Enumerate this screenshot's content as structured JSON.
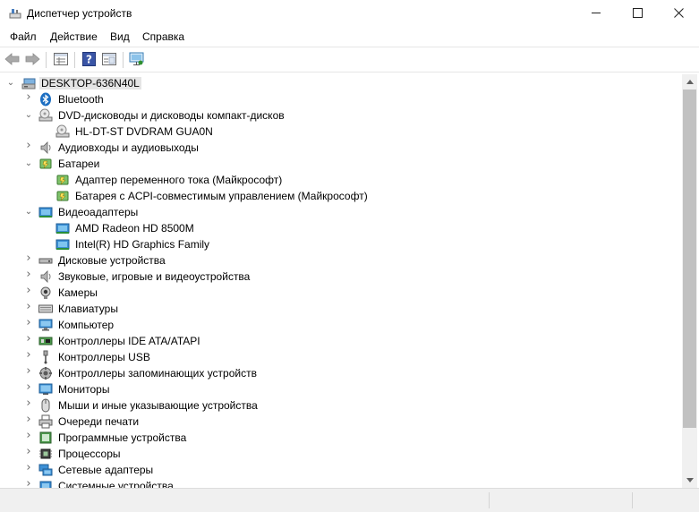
{
  "window": {
    "title": "Диспетчер устройств",
    "icon": "device-manager-icon",
    "controls": [
      "minimize-icon",
      "maximize-icon",
      "close-icon"
    ]
  },
  "menu": {
    "items": [
      "Файл",
      "Действие",
      "Вид",
      "Справка"
    ]
  },
  "toolbar": {
    "buttons": [
      "back-arrow-icon",
      "forward-arrow-icon",
      "properties-view-icon",
      "help-icon",
      "details-pane-icon",
      "scan-hardware-icon"
    ]
  },
  "tree": {
    "root": "DESKTOP-636N40L",
    "items": [
      {
        "label": "Bluetooth",
        "icon": "bluetooth-icon",
        "expanded": false,
        "level": 1
      },
      {
        "label": "DVD-дисководы и дисководы компакт-дисков",
        "icon": "dvd-drive-icon",
        "expanded": true,
        "level": 1
      },
      {
        "label": "HL-DT-ST DVDRAM GUA0N",
        "icon": "dvd-drive-icon",
        "level": 2
      },
      {
        "label": "Аудиовходы и аудиовыходы",
        "icon": "speaker-icon",
        "expanded": false,
        "level": 1
      },
      {
        "label": "Батареи",
        "icon": "battery-icon",
        "expanded": true,
        "level": 1
      },
      {
        "label": "Адаптер переменного тока (Майкрософт)",
        "icon": "battery-icon",
        "level": 2
      },
      {
        "label": "Батарея с ACPI-совместимым управлением (Майкрософт)",
        "icon": "battery-icon",
        "level": 2
      },
      {
        "label": "Видеоадаптеры",
        "icon": "display-adapter-icon",
        "expanded": true,
        "level": 1
      },
      {
        "label": "AMD Radeon HD 8500M",
        "icon": "display-adapter-icon",
        "level": 2
      },
      {
        "label": "Intel(R) HD Graphics Family",
        "icon": "display-adapter-icon",
        "level": 2
      },
      {
        "label": "Дисковые устройства",
        "icon": "disk-drive-icon",
        "expanded": false,
        "level": 1
      },
      {
        "label": "Звуковые, игровые и видеоустройства",
        "icon": "speaker-icon",
        "expanded": false,
        "level": 1
      },
      {
        "label": "Камеры",
        "icon": "camera-icon",
        "expanded": false,
        "level": 1
      },
      {
        "label": "Клавиатуры",
        "icon": "keyboard-icon",
        "expanded": false,
        "level": 1
      },
      {
        "label": "Компьютер",
        "icon": "computer-icon",
        "expanded": false,
        "level": 1
      },
      {
        "label": "Контроллеры IDE ATA/ATAPI",
        "icon": "ide-controller-icon",
        "expanded": false,
        "level": 1
      },
      {
        "label": "Контроллеры USB",
        "icon": "usb-icon",
        "expanded": false,
        "level": 1
      },
      {
        "label": "Контроллеры запоминающих устройств",
        "icon": "storage-controller-icon",
        "expanded": false,
        "level": 1
      },
      {
        "label": "Мониторы",
        "icon": "monitor-icon",
        "expanded": false,
        "level": 1
      },
      {
        "label": "Мыши и иные указывающие устройства",
        "icon": "mouse-icon",
        "expanded": false,
        "level": 1
      },
      {
        "label": "Очереди печати",
        "icon": "printer-icon",
        "expanded": false,
        "level": 1
      },
      {
        "label": "Программные устройства",
        "icon": "software-device-icon",
        "expanded": false,
        "level": 1
      },
      {
        "label": "Процессоры",
        "icon": "processor-icon",
        "expanded": false,
        "level": 1
      },
      {
        "label": "Сетевые адаптеры",
        "icon": "network-adapter-icon",
        "expanded": false,
        "level": 1
      },
      {
        "label": "Системные устройства",
        "icon": "system-device-icon",
        "expanded": false,
        "level": 1
      }
    ]
  },
  "colors": {
    "selection": "#e5e5e5",
    "scrollbar_thumb": "#c1c1c1",
    "status_bar": "#f0f0f0"
  }
}
